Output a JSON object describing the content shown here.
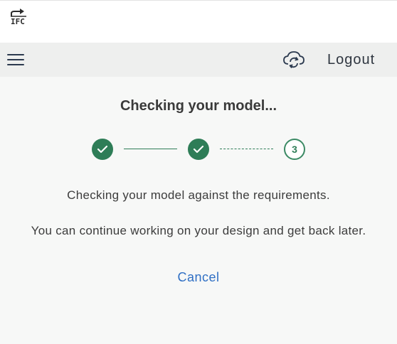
{
  "app": {
    "logo_text": "IFC"
  },
  "navbar": {
    "menu_icon": "hamburger-menu-icon",
    "sync_icon": "cloud-sync-icon",
    "logout_label": "Logout"
  },
  "main": {
    "title": "Checking your model...",
    "stepper": {
      "steps": [
        {
          "state": "done",
          "icon": "check-icon"
        },
        {
          "state": "done",
          "icon": "check-icon"
        },
        {
          "state": "current",
          "label": "3"
        }
      ]
    },
    "message_primary": "Checking your model against the requirements.",
    "message_secondary": "You can continue working on your design and get back later.",
    "cancel_label": "Cancel"
  },
  "colors": {
    "accent_green": "#2e7d57",
    "link_blue": "#2f6fc4",
    "navbar_bg": "#eeefee",
    "page_bg": "#f7f8f7"
  }
}
